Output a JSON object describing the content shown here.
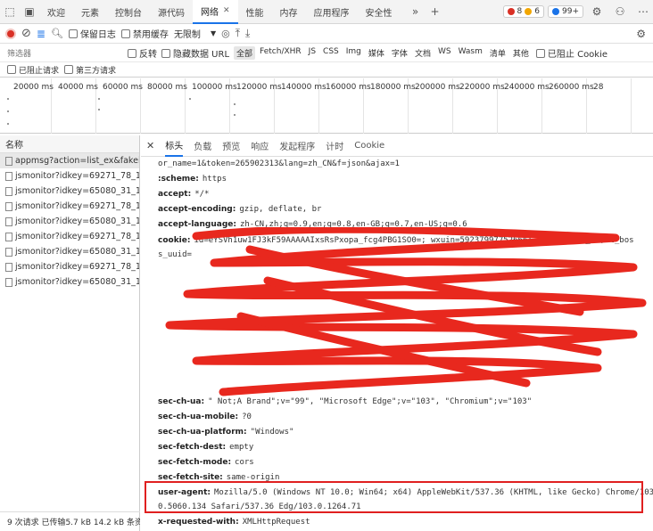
{
  "tabs": [
    {
      "label": "欢迎",
      "active": false
    },
    {
      "label": "元素",
      "active": false
    },
    {
      "label": "控制台",
      "active": false
    },
    {
      "label": "源代码",
      "active": false
    },
    {
      "label": "网络",
      "active": true
    },
    {
      "label": "性能",
      "active": false
    },
    {
      "label": "内存",
      "active": false
    },
    {
      "label": "应用程序",
      "active": false
    },
    {
      "label": "安全性",
      "active": false
    }
  ],
  "badges": {
    "errors": "8",
    "warnings": "6",
    "info": "99+"
  },
  "toolbar": {
    "preserve_log": "保留日志",
    "disable_cache": "禁用缓存",
    "throttle": "无限制"
  },
  "filter": {
    "placeholder": "筛选器",
    "invert": "反转",
    "hide_data_urls": "隐藏数据 URL",
    "types": [
      "全部",
      "Fetch/XHR",
      "JS",
      "CSS",
      "Img",
      "媒体",
      "字体",
      "文档",
      "WS",
      "Wasm",
      "清单",
      "其他"
    ],
    "blocked_cookies": "已阻止 Cookie",
    "blocked_requests": "已阻止请求",
    "third_party": "第三方请求"
  },
  "timeline_ticks": [
    "20000 ms",
    "40000 ms",
    "60000 ms",
    "80000 ms",
    "100000 ms",
    "120000 ms",
    "140000 ms",
    "160000 ms",
    "180000 ms",
    "200000 ms",
    "220000 ms",
    "240000 ms",
    "260000 ms",
    "28"
  ],
  "requests": {
    "header": "名称",
    "items": [
      "appmsg?action=list_ex&fakei...",
      "jsmonitor?idkey=69271_78_1...",
      "jsmonitor?idkey=65080_31_1...",
      "jsmonitor?idkey=69271_78_1...",
      "jsmonitor?idkey=65080_31_1...",
      "jsmonitor?idkey=69271_78_1...",
      "jsmonitor?idkey=65080_31_1...",
      "jsmonitor?idkey=69271_78_1...",
      "jsmonitor?idkey=65080_31_1..."
    ],
    "status": "9 次请求  已传输5.7 kB  14.2 kB 条资"
  },
  "detail_tabs": [
    "标头",
    "负载",
    "预览",
    "响应",
    "发起程序",
    "计时",
    "Cookie"
  ],
  "headers": {
    "top_line": "or_name=1&token=265902313&lang=zh_CN&f=json&ajax=1",
    "scheme": {
      "k": ":scheme:",
      "v": "https"
    },
    "accept": {
      "k": "accept:",
      "v": "*/*"
    },
    "accept_encoding": {
      "k": "accept-encoding:",
      "v": "gzip, deflate, br"
    },
    "accept_language": {
      "k": "accept-language:",
      "v": "zh-CN,zh;q=0.9,en;q=0.8,en-GB;q=0.7,en-US;q=0.6"
    },
    "cookie": {
      "k": "cookie:",
      "v": "id=eYSVh1uw1FJ3kF59AAAAAIxsRsPxopa_fcg4PBG1SO0=; wxuin=59237997752666; mm_lang=zh_CN; t_bos"
    },
    "cookie_line2": "s_uuid=",
    "cookie_line3": "",
    "sec_ch_ua": {
      "k": "sec-ch-ua:",
      "v": "\" Not;A Brand\";v=\"99\", \"Microsoft Edge\";v=\"103\", \"Chromium\";v=\"103\""
    },
    "sec_ch_ua_mobile": {
      "k": "sec-ch-ua-mobile:",
      "v": "?0"
    },
    "sec_ch_ua_platform": {
      "k": "sec-ch-ua-platform:",
      "v": "\"Windows\""
    },
    "sec_fetch_dest": {
      "k": "sec-fetch-dest:",
      "v": "empty"
    },
    "sec_fetch_mode": {
      "k": "sec-fetch-mode:",
      "v": "cors"
    },
    "sec_fetch_site": {
      "k": "sec-fetch-site:",
      "v": "same-origin"
    },
    "user_agent": {
      "k": "user-agent:",
      "v": "Mozilla/5.0 (Windows NT 10.0; Win64; x64) AppleWebKit/537.36 (KHTML, like Gecko) Chrome/103.",
      "v2": "0.5060.134 Safari/537.36 Edg/103.0.1264.71"
    },
    "x_requested_with": {
      "k": "x-requested-with:",
      "v": "XMLHttpRequest"
    }
  },
  "colors": {
    "accent": "#1a73e8",
    "highlight_box": "#e02020",
    "scribble": "#e8281e"
  }
}
